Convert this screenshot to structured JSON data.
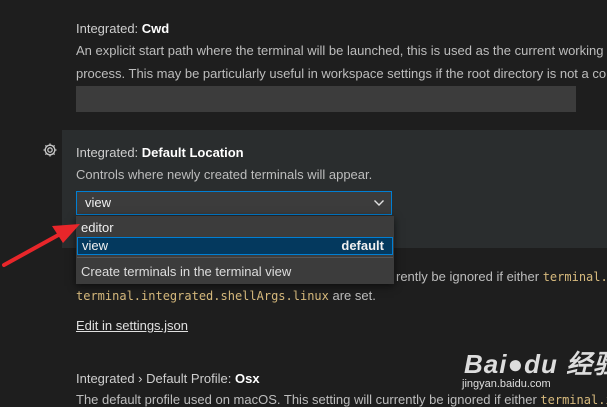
{
  "cwd_setting": {
    "category": "Integrated: ",
    "name": "Cwd",
    "description_line1": "An explicit start path where the terminal will be launched, this is used as the current working",
    "description_line2": "process. This may be particularly useful in workspace settings if the root directory is not a co",
    "value": ""
  },
  "default_location_setting": {
    "category": "Integrated: ",
    "name": "Default Location",
    "description": "Controls where newly created terminals will appear.",
    "selected_value": "view",
    "options": [
      {
        "label": "editor",
        "badge": ""
      },
      {
        "label": "view",
        "badge": "default"
      }
    ],
    "option_description": "Create terminals in the terminal view"
  },
  "shell_args_note": {
    "line1_text": "rently be ignored if either ",
    "line1_code": "terminal.in",
    "line2_code": "terminal.integrated.shellArgs.linux",
    "line2_text": " are set."
  },
  "edit_link": "Edit in settings.json",
  "osx_setting": {
    "category": "Integrated › Default Profile: ",
    "name": "Osx",
    "description_text": "The default profile used on macOS. This setting will currently be ignored if either ",
    "description_code": "terminal.i"
  },
  "watermark": {
    "brand": "Bai●du 经验",
    "url": "jingyan.baidu.com"
  },
  "icons": {
    "gear": "gear-icon",
    "chevron": "chevron-down-icon"
  },
  "colors": {
    "background": "#1e1e1e",
    "focus_border": "#007fd4",
    "selected_option": "#04395e",
    "arrow": "#e8262a"
  }
}
